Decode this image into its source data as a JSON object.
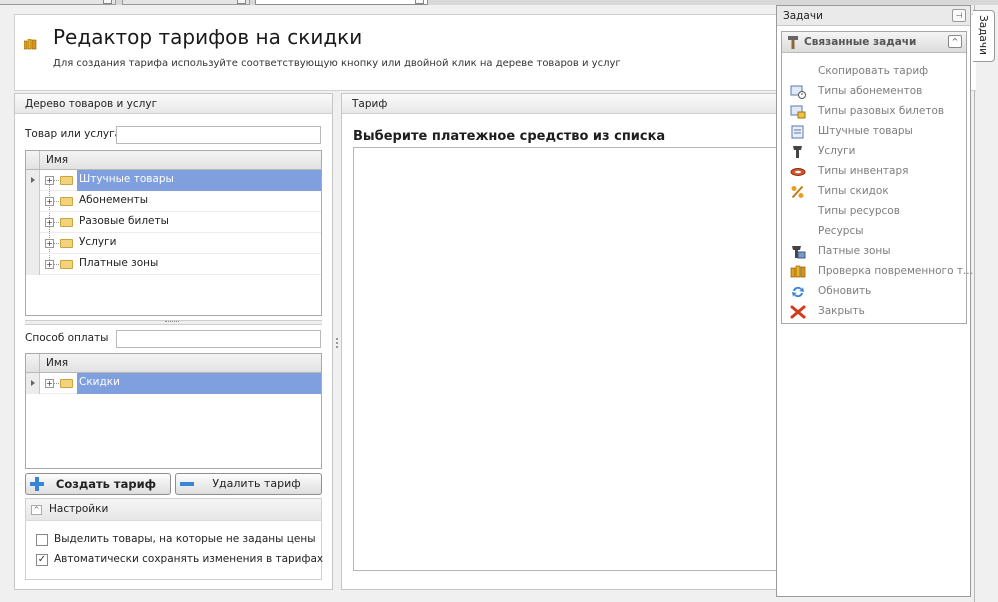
{
  "header": {
    "title": "Редактор тарифов на скидки",
    "subtitle": "Для создания тарифа используйте соответствующую кнопку или двойной клик на дереве товаров и услуг"
  },
  "left_panel": {
    "title": "Дерево товаров и услуг",
    "product_filter": {
      "label": "Товар или услуга",
      "value": ""
    },
    "tree": {
      "column": "Имя",
      "items": [
        {
          "label": "Штучные товары",
          "selected": true
        },
        {
          "label": "Абонементы",
          "selected": false
        },
        {
          "label": "Разовые билеты",
          "selected": false
        },
        {
          "label": "Услуги",
          "selected": false
        },
        {
          "label": "Платные зоны",
          "selected": false
        }
      ]
    },
    "payment_filter": {
      "label": "Способ оплаты",
      "value": ""
    },
    "payment_tree": {
      "column": "Имя",
      "items": [
        {
          "label": "Скидки",
          "selected": true
        }
      ]
    },
    "buttons": {
      "create": "Создать тариф",
      "delete": "Удалить тариф"
    },
    "settings": {
      "title": "Настройки",
      "options": [
        {
          "label": "Выделить товары, на которые не заданы цены",
          "checked": false
        },
        {
          "label": "Автоматически сохранять изменения в тарифах",
          "checked": true
        }
      ]
    }
  },
  "right_panel": {
    "title": "Тариф",
    "message": "Выберите платежное средство из списка"
  },
  "tasks": {
    "title": "Задачи",
    "side_tab": "Задачи",
    "group_title": "Связанные задачи",
    "items": [
      {
        "label": "Скопировать тариф",
        "icon": "copy-icon"
      },
      {
        "label": "Типы абонементов",
        "icon": "subscription-types-icon"
      },
      {
        "label": "Типы разовых билетов",
        "icon": "ticket-types-icon"
      },
      {
        "label": "Штучные товары",
        "icon": "items-icon"
      },
      {
        "label": "Услуги",
        "icon": "services-icon"
      },
      {
        "label": "Типы инвентаря",
        "icon": "inventory-icon"
      },
      {
        "label": "Типы скидок",
        "icon": "discount-icon"
      },
      {
        "label": "Типы ресурсов",
        "icon": "resource-types-icon"
      },
      {
        "label": "Ресурсы",
        "icon": "resources-icon"
      },
      {
        "label": "Патные зоны",
        "icon": "zones-icon"
      },
      {
        "label": "Проверка повременного т...",
        "icon": "time-check-icon"
      },
      {
        "label": "Обновить",
        "icon": "refresh-icon"
      },
      {
        "label": "Закрыть",
        "icon": "close-icon"
      }
    ]
  },
  "colors": {
    "selection": "#7f9fdf",
    "accent_blue": "#3a86d6",
    "close_red": "#d23a1e"
  }
}
